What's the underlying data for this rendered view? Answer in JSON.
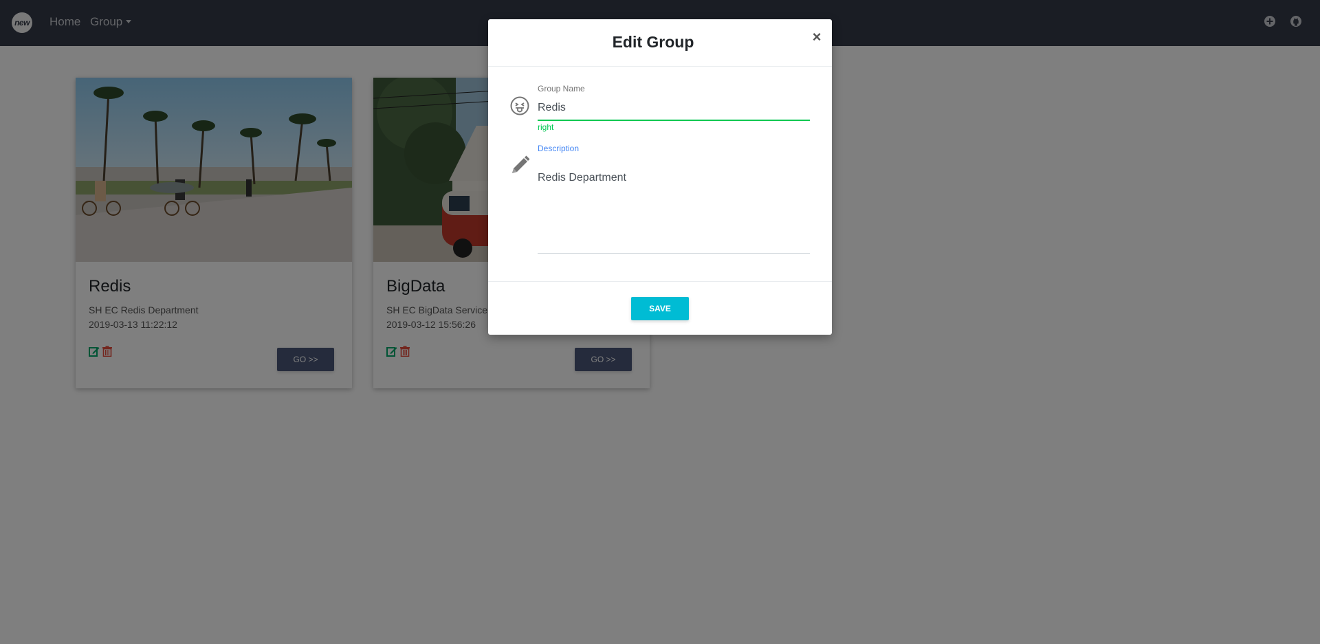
{
  "navbar": {
    "logo_text": "new",
    "home_label": "Home",
    "group_label": "Group",
    "icons": [
      "plus-circle-icon",
      "github-icon"
    ]
  },
  "cards": [
    {
      "title": "Redis",
      "description": "SH EC Redis Department",
      "date": "2019-03-13 11:22:12",
      "go_label": "GO >>",
      "image": "beach-bikes-palm-trees-photo"
    },
    {
      "title": "BigData",
      "description": "SH EC BigData Service",
      "date": "2019-03-12 15:56:26",
      "go_label": "GO >>",
      "image": "van-street-houses-photo"
    }
  ],
  "modal": {
    "title": "Edit Group",
    "close_label": "×",
    "group_name_label": "Group Name",
    "group_name_value": "Redis",
    "group_name_valid_msg": "right",
    "description_label": "Description",
    "description_value": "Redis Department",
    "save_label": "SAVE"
  },
  "colors": {
    "navbar": "#343a48",
    "go_button": "#4b5778",
    "save_button": "#00bcd4",
    "valid": "#00c851",
    "focus_label": "#4285f4",
    "edit_icon": "#00a86b",
    "delete_icon": "#e74c3c"
  }
}
